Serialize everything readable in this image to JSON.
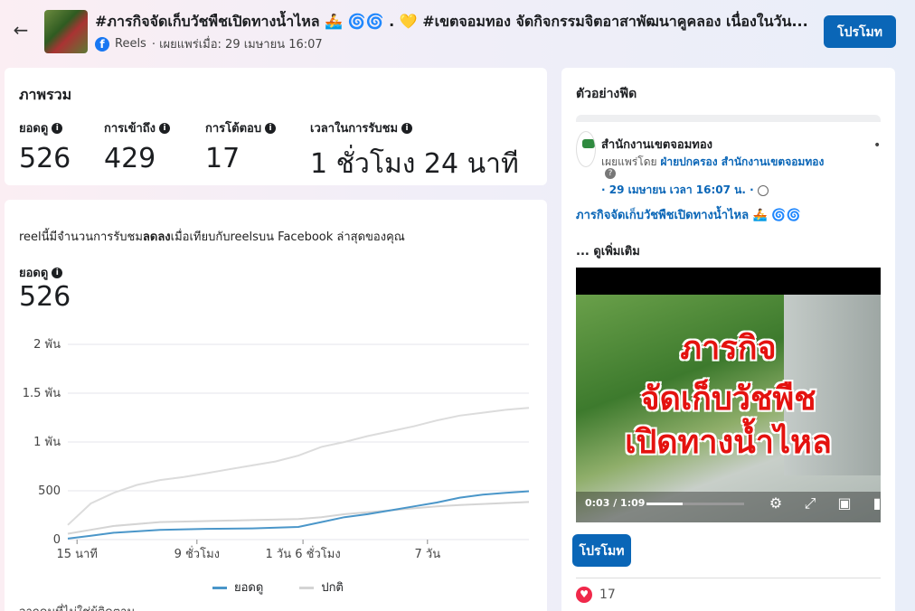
{
  "header": {
    "title": "#ภารกิจจัดเก็บวัชพืชเปิดทางน้ำไหล 🚣 🌀🌀 . 💛 #เขตจอมทอง จัดกิจกรรมจิตอาสาพัฒนาคูคลอง เนื่องในวัน...",
    "platform_icon": "facebook-icon",
    "platform": "Reels",
    "published": "· เผยแพร่เมื่อ: 29 เมษายน 16:07",
    "promote_label": "โปรโมท",
    "back_icon": "arrow-left-icon"
  },
  "overview": {
    "title": "ภาพรวม",
    "metrics": [
      {
        "label": "ยอดดู",
        "value": "526"
      },
      {
        "label": "การเข้าถึง",
        "value": "429"
      },
      {
        "label": "การโต้ตอบ",
        "value": "17"
      },
      {
        "label": "เวลาในการรับชม",
        "value": "1 ชั่วโมง 24 นาที"
      }
    ]
  },
  "performance": {
    "note_prefix": "reelนี้มีจำนวนการรับชม",
    "note_bold": "ลดลง",
    "note_suffix": "เมื่อเทียบกับreelsบน Facebook ล่าสุดของคุณ",
    "views_label": "ยอดดู",
    "views_value": "526",
    "footnote": "จากคนที่ไม่ใช่ผู้ติดตาม"
  },
  "chart_data": {
    "type": "line",
    "title": "",
    "xlabel": "",
    "ylabel": "",
    "x_ticks": [
      "15 นาที",
      "9 ชั่วโมง",
      "1 วัน 6 ชั่วโมง",
      "7 วัน"
    ],
    "y_ticks": [
      "0",
      "500",
      "1 พัน",
      "1.5 พัน",
      "2 พัน"
    ],
    "ylim": [
      0,
      2000
    ],
    "xlim": [
      0,
      100
    ],
    "grid": true,
    "legend_position": "bottom",
    "series": [
      {
        "name": "ยอดดู",
        "color": "#4a96c9",
        "x": [
          0,
          5,
          10,
          20,
          30,
          40,
          50,
          55,
          60,
          65,
          70,
          75,
          80,
          85,
          90,
          95,
          100
        ],
        "y": [
          10,
          40,
          70,
          100,
          110,
          115,
          130,
          180,
          230,
          260,
          300,
          340,
          380,
          430,
          460,
          480,
          495
        ]
      },
      {
        "name": "ปกติ",
        "color": "#d4d4d4",
        "x": [
          0,
          5,
          10,
          20,
          30,
          40,
          50,
          55,
          60,
          65,
          70,
          75,
          80,
          85,
          90,
          95,
          100
        ],
        "y": [
          60,
          100,
          140,
          180,
          190,
          200,
          210,
          230,
          260,
          280,
          300,
          320,
          340,
          355,
          365,
          375,
          385
        ]
      },
      {
        "name": "",
        "color": "#dcdcdc",
        "x": [
          0,
          5,
          10,
          15,
          20,
          25,
          30,
          35,
          40,
          45,
          50,
          55,
          60,
          65,
          70,
          75,
          80,
          85,
          90,
          95,
          100
        ],
        "y": [
          150,
          370,
          480,
          560,
          610,
          640,
          680,
          720,
          760,
          800,
          860,
          950,
          1000,
          1060,
          1110,
          1160,
          1220,
          1270,
          1300,
          1330,
          1350
        ]
      }
    ]
  },
  "feed_preview": {
    "title": "ตัวอย่างฟีด",
    "page_name": "สำนักงานเขตจอมทอง",
    "published_by": "เผยแพร่โดย",
    "publisher": "ฝ่ายปกครอง สำนักงานเขตจอมทอง",
    "date": "· 29 เมษายน เวลา 16:07 น. ·",
    "caption": "ภารกิจจัดเก็บวัชพืชเปิดทางน้ำไหล 🚣 🌀🌀",
    "see_more": "... ดูเพิ่มเติม",
    "video_text": [
      "ภารกิจ",
      "จัดเก็บวัชพืช",
      "เปิดทางน้ำไหล"
    ],
    "video_time": "0:03 / 1:09",
    "promote_label": "โปรโมท",
    "reaction_count": "17"
  }
}
